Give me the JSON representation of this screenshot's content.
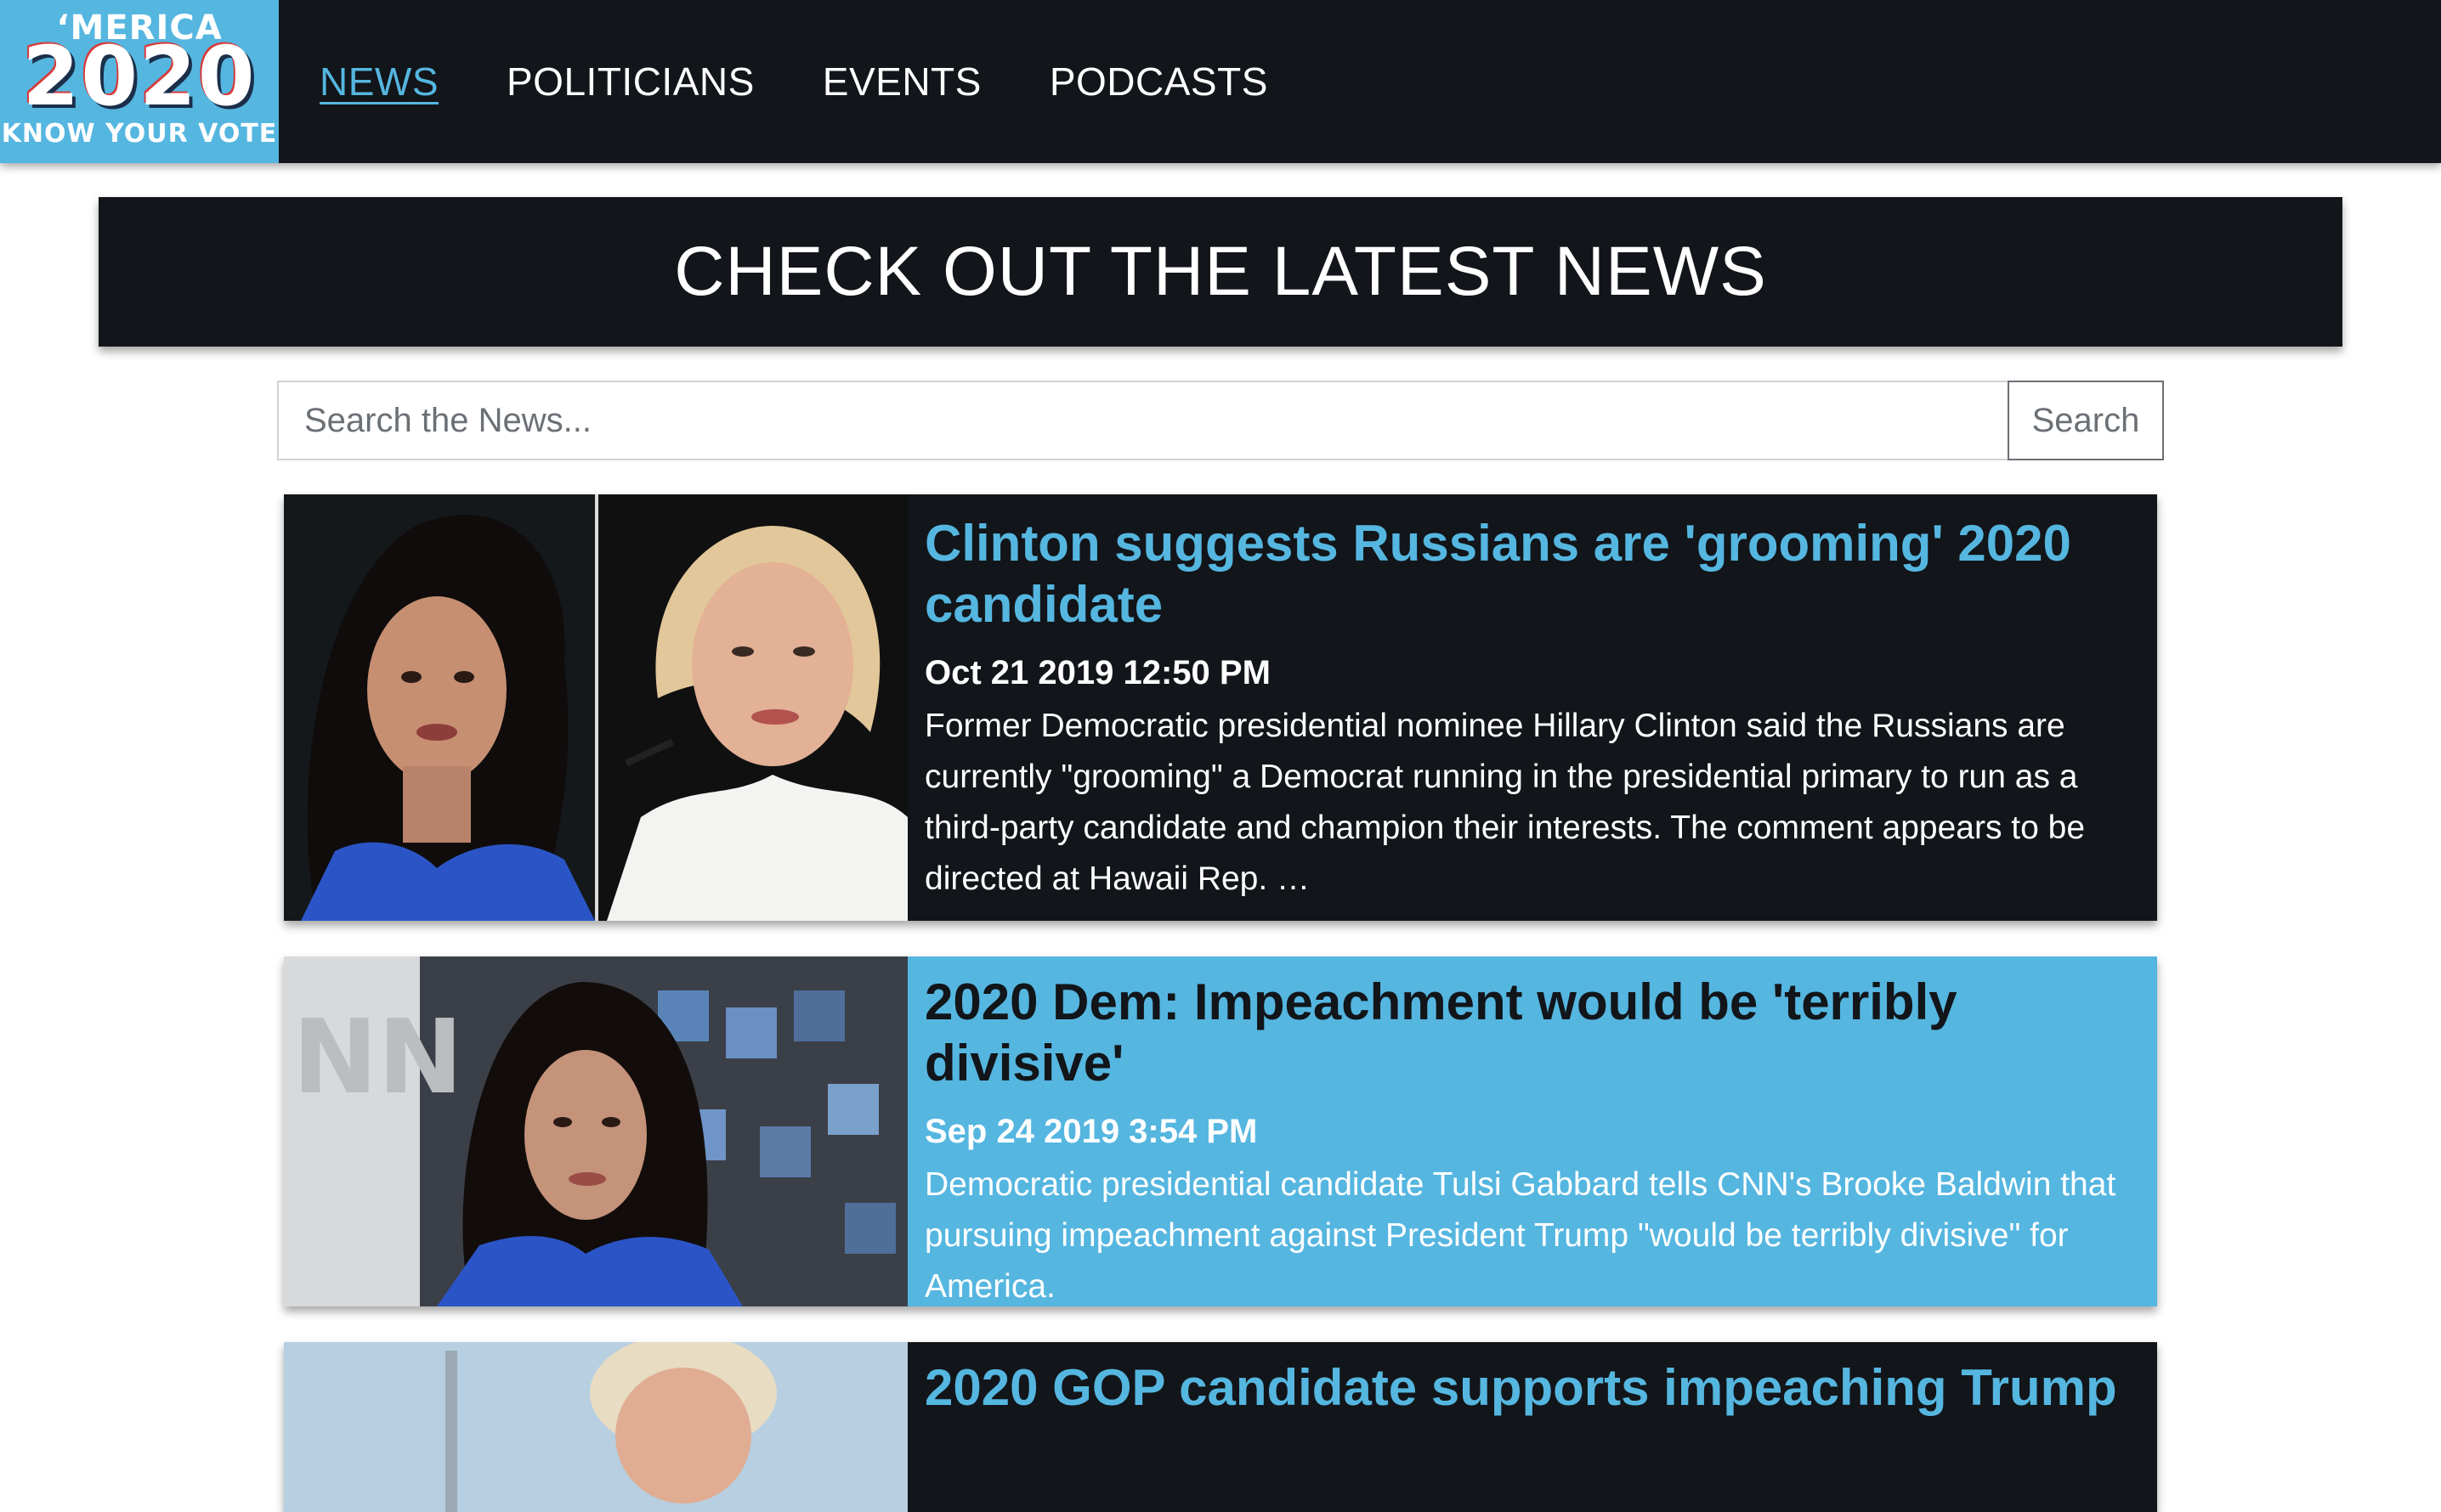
{
  "logo": {
    "line1": "‘MERICA",
    "line2": "2020",
    "line3": "KNOW YOUR VOTE"
  },
  "nav": {
    "items": [
      {
        "label": "NEWS",
        "active": true
      },
      {
        "label": "POLITICIANS",
        "active": false
      },
      {
        "label": "EVENTS",
        "active": false
      },
      {
        "label": "PODCASTS",
        "active": false
      }
    ]
  },
  "banner": {
    "heading": "CHECK OUT THE LATEST NEWS"
  },
  "search": {
    "placeholder": "Search the News...",
    "value": "",
    "button_label": "Search"
  },
  "articles": [
    {
      "title": "Clinton suggests Russians are 'grooming' 2020 candidate",
      "date": "Oct 21 2019 12:50 PM",
      "summary": "Former Democratic presidential nominee Hillary Clinton said the Russians are currently \"grooming\" a Democrat running in the presidential primary to run as a third-party candidate and champion their interests. The comment appears to be directed at Hawaii Rep. …",
      "theme": "dark"
    },
    {
      "title": "2020 Dem: Impeachment would be 'terribly divisive'",
      "date": "Sep 24 2019 3:54 PM",
      "summary": "Democratic presidential candidate Tulsi Gabbard tells CNN's Brooke Baldwin that pursuing impeachment against President Trump \"would be terribly divisive\" for America.",
      "theme": "blue"
    },
    {
      "title": "2020 GOP candidate supports impeaching Trump",
      "theme": "dark"
    }
  ],
  "colors": {
    "accent": "#55b6e0",
    "dark": "#121519",
    "white": "#ffffff"
  }
}
